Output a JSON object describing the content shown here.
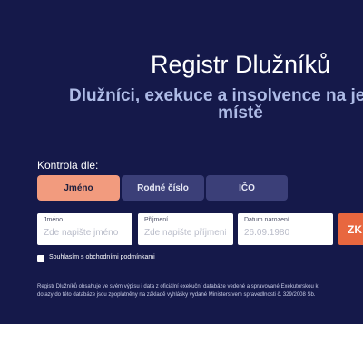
{
  "hero": {
    "title": "Registr Dlužníků",
    "subtitle_line1": "Dlužníci, exekuce a insolvence na jednom",
    "subtitle_line2": "místě"
  },
  "form": {
    "kontrola_label": "Kontrola dle:",
    "tabs": [
      {
        "label": "Jméno",
        "active": true
      },
      {
        "label": "Rodné číslo",
        "active": false
      },
      {
        "label": "IČO",
        "active": false
      }
    ],
    "fields": {
      "jmeno": {
        "label": "Jméno",
        "placeholder": "Zde napište jméno"
      },
      "prijmeni": {
        "label": "Příjmení",
        "placeholder": "Zde napište příjmení"
      },
      "datum": {
        "label": "Datum narození",
        "placeholder": "26.09.1980"
      }
    },
    "search_label": "ZK",
    "consent_prefix": "Souhlasím s ",
    "consent_link": "obchodními podmínkami"
  },
  "info": {
    "line1": "Registr Dlužníků obsahuje ve svém výpisu i data z oficiální exekuční databáze vedené a spravované Exekutorskou k",
    "line2": "dotazy do této databáze jsou zpoplatněny na základě vyhlášky vydané Ministerstvem spravedlnosti č. 329/2008 Sb."
  },
  "colors": {
    "hero_bg": "#15194a",
    "tab_active": "#f29b7e",
    "tab_inactive": "#3b3f78",
    "search_button": "#e8673f",
    "subtitle": "#aebbe6"
  }
}
